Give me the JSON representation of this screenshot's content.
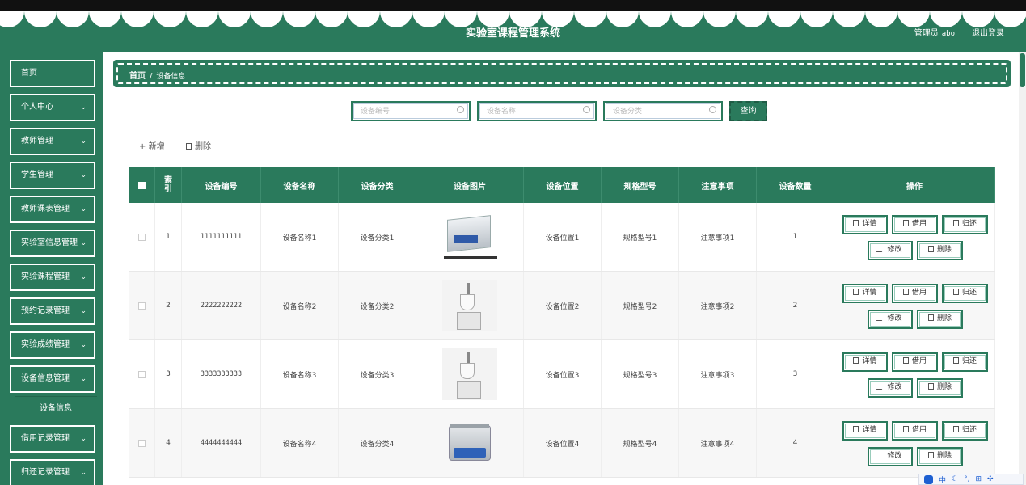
{
  "header": {
    "title": "实验室课程管理系统",
    "role": "管理员",
    "username": "abo",
    "logout": "退出登录"
  },
  "sidebar": {
    "items": [
      {
        "label": "首页",
        "has_submenu": false
      },
      {
        "label": "个人中心",
        "has_submenu": true
      },
      {
        "label": "教师管理",
        "has_submenu": true
      },
      {
        "label": "学生管理",
        "has_submenu": true
      },
      {
        "label": "教师课表管理",
        "has_submenu": true
      },
      {
        "label": "实验室信息管理",
        "has_submenu": true
      },
      {
        "label": "实验课程管理",
        "has_submenu": true
      },
      {
        "label": "预约记录管理",
        "has_submenu": true
      },
      {
        "label": "实验成绩管理",
        "has_submenu": true
      },
      {
        "label": "设备信息管理",
        "has_submenu": true
      },
      {
        "label": "借用记录管理",
        "has_submenu": true
      },
      {
        "label": "归还记录管理",
        "has_submenu": true
      }
    ],
    "active_sub": "设备信息"
  },
  "breadcrumb": {
    "home": "首页",
    "separator": "/",
    "current": "设备信息"
  },
  "search": {
    "fields": [
      {
        "placeholder": "设备编号"
      },
      {
        "placeholder": "设备名称"
      },
      {
        "placeholder": "设备分类"
      }
    ],
    "button": "查询"
  },
  "toolbar": {
    "add_icon": "+",
    "add": "新增",
    "delete": "删除"
  },
  "table": {
    "columns": [
      "索引",
      "设备编号",
      "设备名称",
      "设备分类",
      "设备图片",
      "设备位置",
      "规格型号",
      "注意事项",
      "设备数量",
      "操作"
    ],
    "rows": [
      {
        "index": "1",
        "code": "1111111111",
        "name": "设备名称1",
        "category": "设备分类1",
        "image": "ultrasonic-cleaner",
        "location": "设备位置1",
        "model": "规格型号1",
        "notes": "注意事项1",
        "quantity": "1"
      },
      {
        "index": "2",
        "code": "2222222222",
        "name": "设备名称2",
        "category": "设备分类2",
        "image": "lab-reactor",
        "location": "设备位置2",
        "model": "规格型号2",
        "notes": "注意事项2",
        "quantity": "2"
      },
      {
        "index": "3",
        "code": "3333333333",
        "name": "设备名称3",
        "category": "设备分类3",
        "image": "lab-reactor",
        "location": "设备位置3",
        "model": "规格型号3",
        "notes": "注意事项3",
        "quantity": "3"
      },
      {
        "index": "4",
        "code": "4444444444",
        "name": "设备名称4",
        "category": "设备分类4",
        "image": "ultrasonic-bath",
        "location": "设备位置4",
        "model": "规格型号4",
        "notes": "注意事项4",
        "quantity": "4"
      }
    ],
    "actions": {
      "detail": "详情",
      "borrow": "借用",
      "return": "归还",
      "edit": "修改",
      "delete": "删除"
    }
  },
  "ime": {
    "chinese": "中"
  },
  "colors": {
    "primary": "#2a7a5c",
    "accent": "#1d5fd1"
  }
}
